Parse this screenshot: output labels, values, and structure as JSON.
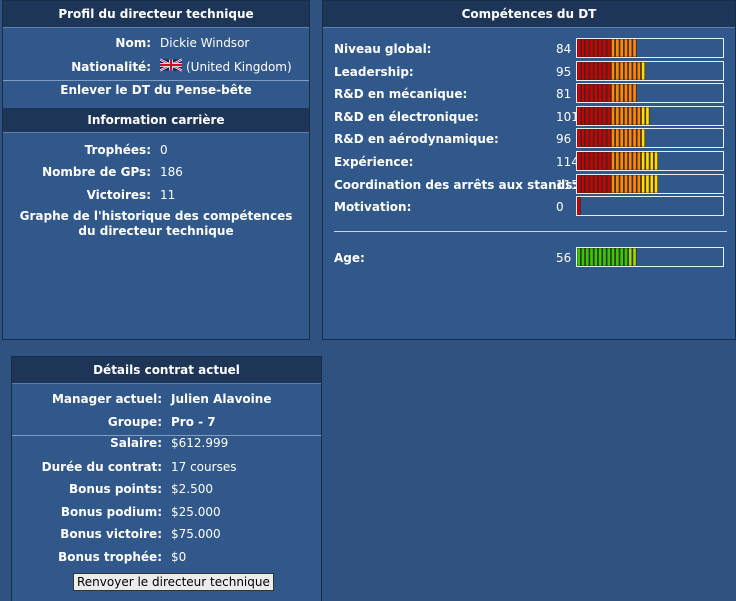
{
  "profile": {
    "title": "Profil du directeur technique",
    "name_label": "Nom:",
    "name_value": "Dickie Windsor",
    "nationality_label": "Nationalité:",
    "nationality_value": "(United Kingdom)",
    "flag_icon": "uk-flag-icon",
    "remove_link": "Enlever le DT du Pense-bête"
  },
  "career": {
    "title": "Information carrière",
    "trophies_label": "Trophées:",
    "trophies_value": "0",
    "gps_label": "Nombre de GPs:",
    "gps_value": "186",
    "wins_label": "Victoires:",
    "wins_value": "11",
    "history_link": "Graphe de l'historique des compétences du directeur technique"
  },
  "skills": {
    "title": "Compétences du DT",
    "items": [
      {
        "label": "Niveau global:",
        "value": "84"
      },
      {
        "label": "Leadership:",
        "value": "95"
      },
      {
        "label": "R&D en mécanique:",
        "value": "81"
      },
      {
        "label": "R&D en électronique:",
        "value": "101"
      },
      {
        "label": "R&D en aérodynamique:",
        "value": "96"
      },
      {
        "label": "Expérience:",
        "value": "114"
      },
      {
        "label": "Coordination des arrêts aux stands:",
        "value": "115"
      },
      {
        "label": "Motivation:",
        "value": "0"
      }
    ],
    "age_label": "Age:",
    "age_value": "56",
    "colors": {
      "low": "#cc0000",
      "mid": "#ff8800",
      "high": "#ffdd00",
      "age_green": "#33cc00"
    }
  },
  "contract": {
    "title": "Détails contrat actuel",
    "manager_label": "Manager actuel:",
    "manager_value": "Julien Alavoine",
    "group_label": "Groupe:",
    "group_value": "Pro - 7",
    "salary_label": "Salaire:",
    "salary_value": "$612.999",
    "duration_label": "Durée du contrat:",
    "duration_value": "17 courses",
    "bonus_points_label": "Bonus points:",
    "bonus_points_value": "$2.500",
    "bonus_podium_label": "Bonus podium:",
    "bonus_podium_value": "$25.000",
    "bonus_win_label": "Bonus victoire:",
    "bonus_win_value": "$75.000",
    "bonus_trophy_label": "Bonus trophée:",
    "bonus_trophy_value": "$0",
    "fire_button": "Renvoyer le directeur technique"
  }
}
